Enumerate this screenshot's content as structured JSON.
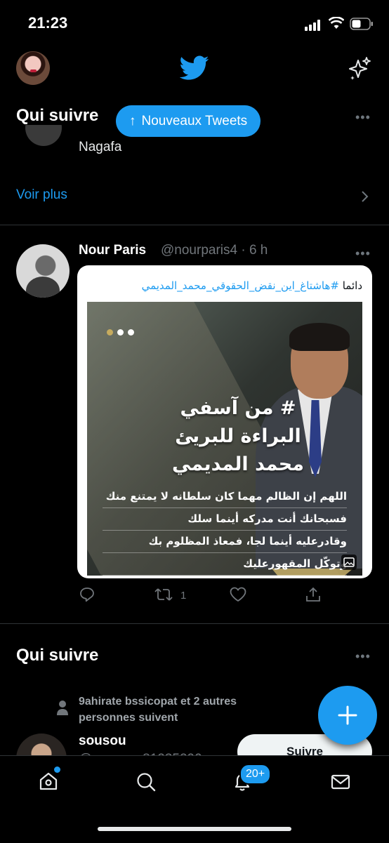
{
  "status_bar": {
    "time": "21:23"
  },
  "header": {
    "logo": "twitter-bird-icon",
    "action_icon": "sparkle-icon"
  },
  "who_to_follow_top": {
    "title": "Qui suivre",
    "partial_user_name": "Nagafa",
    "see_more": "Voir plus"
  },
  "new_tweets_pill": {
    "arrow": "↑",
    "label": "Nouveaux Tweets"
  },
  "tweet": {
    "author": "Nour Paris",
    "handle_time": "@nourparis4 · 6 h",
    "card_text_prefix": "دائما",
    "card_hashtag": "#هاشتاغ_اين_نقض_الحقوقي_محمد_المديمي",
    "image_title": "# من آسفي\nالبراءة للبريئ\nمحمد المديمي",
    "image_lines": [
      "اللهم إن الظالم مهما كان سلطانه لا يمتنع منك",
      "فسبحانك أنت مدركه أينما سلك",
      "وقادرعليه أينما لجا، فمعاذ المظلوم بك",
      "وتوكّل المقهورعليك"
    ],
    "retweet_count": "1"
  },
  "who_to_follow_bottom": {
    "title": "Qui suivre",
    "social_context": "9ahirate bssicopat et 2 autres personnes suivent",
    "user_name": "sousou",
    "user_handle": "@sousou_81235290",
    "follow_label": "Suivre"
  },
  "tab_bar": {
    "notifications_badge": "20+"
  },
  "colors": {
    "accent": "#1d9bf0",
    "background": "#000000",
    "muted": "#71767b"
  }
}
